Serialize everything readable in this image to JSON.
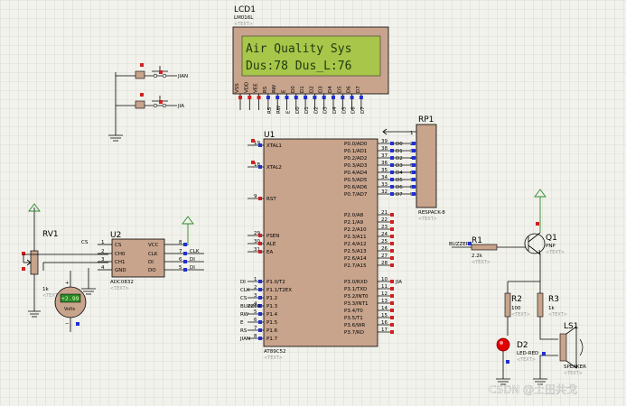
{
  "lcd": {
    "ref": "LCD1",
    "model": "LM016L",
    "text_tag": "<TEXT>",
    "line1": "Air Quality Sys",
    "line2": "Dus:78  Dus_L:76",
    "pins": [
      "VSS",
      "VDD",
      "VEE",
      "RS",
      "RW",
      "E",
      "D0",
      "D1",
      "D2",
      "D3",
      "D4",
      "D5",
      "D6",
      "D7"
    ],
    "nets": [
      "RS",
      "RW",
      "E",
      "D0",
      "D1",
      "D2",
      "D3",
      "D4",
      "D5",
      "D6",
      "D7"
    ]
  },
  "mcu": {
    "ref": "U1",
    "model": "AT89C52",
    "text_tag": "<TEXT>",
    "left_pins": [
      {
        "num": "19",
        "name": "XTAL1"
      },
      {
        "num": "18",
        "name": "XTAL2"
      },
      {
        "num": "9",
        "name": "RST"
      },
      {
        "num": "29",
        "name": "PSEN"
      },
      {
        "num": "30",
        "name": "ALE"
      },
      {
        "num": "31",
        "name": "EA"
      },
      {
        "num": "1",
        "name": "P1.0/T2"
      },
      {
        "num": "2",
        "name": "P1.1/T2EX"
      },
      {
        "num": "3",
        "name": "P1.2"
      },
      {
        "num": "4",
        "name": "P1.3"
      },
      {
        "num": "5",
        "name": "P1.4"
      },
      {
        "num": "6",
        "name": "P1.5"
      },
      {
        "num": "7",
        "name": "P1.6"
      },
      {
        "num": "8",
        "name": "P1.7"
      }
    ],
    "left_nets": [
      "DI",
      "CLK",
      "CS",
      "BUZZER",
      "RW",
      "E",
      "RS",
      "JIAN"
    ],
    "right_p0": [
      {
        "num": "39",
        "name": "P0.0/AD0"
      },
      {
        "num": "38",
        "name": "P0.1/AD1"
      },
      {
        "num": "37",
        "name": "P0.2/AD2"
      },
      {
        "num": "36",
        "name": "P0.3/AD3"
      },
      {
        "num": "35",
        "name": "P0.4/AD4"
      },
      {
        "num": "34",
        "name": "P0.5/AD5"
      },
      {
        "num": "33",
        "name": "P0.6/AD6"
      },
      {
        "num": "32",
        "name": "P0.7/AD7"
      }
    ],
    "p0_nets": [
      "D0",
      "D1",
      "D2",
      "D3",
      "D4",
      "D5",
      "D6",
      "D7"
    ],
    "right_p2": [
      {
        "num": "21",
        "name": "P2.0/A8"
      },
      {
        "num": "22",
        "name": "P2.1/A9"
      },
      {
        "num": "23",
        "name": "P2.2/A10"
      },
      {
        "num": "24",
        "name": "P2.3/A11"
      },
      {
        "num": "25",
        "name": "P2.4/A12"
      },
      {
        "num": "26",
        "name": "P2.5/A13"
      },
      {
        "num": "27",
        "name": "P2.6/A14"
      },
      {
        "num": "28",
        "name": "P2.7/A15"
      }
    ],
    "right_p3": [
      {
        "num": "10",
        "name": "P3.0/RXD"
      },
      {
        "num": "11",
        "name": "P3.1/TXD"
      },
      {
        "num": "12",
        "name": "P3.2/INT0"
      },
      {
        "num": "13",
        "name": "P3.3/INT1"
      },
      {
        "num": "14",
        "name": "P3.4/T0"
      },
      {
        "num": "15",
        "name": "P3.5/T1"
      },
      {
        "num": "16",
        "name": "P3.6/WR"
      },
      {
        "num": "17",
        "name": "P3.7/RD"
      }
    ],
    "p3_net": "JIA"
  },
  "rp1": {
    "ref": "RP1",
    "model": "RESPACK-8",
    "text_tag": "<TEXT>",
    "pin1": "1",
    "pins": [
      "2",
      "3",
      "4",
      "5",
      "6",
      "7",
      "8",
      "9"
    ]
  },
  "adc": {
    "ref": "U2",
    "model": "ADC0832",
    "text_tag": "<TEXT>",
    "left_pins": [
      "CS",
      "CH0",
      "CH1",
      "GND"
    ],
    "right_pins": [
      "VCC",
      "CLK",
      "DI",
      "DO"
    ],
    "left_nums": [
      "1",
      "2",
      "3",
      "4"
    ],
    "right_nums": [
      "8",
      "7",
      "6",
      "5"
    ],
    "left_net": "CS",
    "right_nets": [
      "CLK",
      "DI",
      "DI"
    ]
  },
  "rv1": {
    "ref": "RV1",
    "value": "1k",
    "text_tag": "<TEXT>"
  },
  "voltmeter": {
    "reading": "+2.99",
    "unit": "Volts"
  },
  "buttons": [
    {
      "net": "JIAN"
    },
    {
      "net": "JIA"
    }
  ],
  "buzzer_net": "BUZZER",
  "r1": {
    "ref": "R1",
    "value": "2.2k",
    "text_tag": "<TEXT>"
  },
  "q1": {
    "ref": "Q1",
    "model": "PNP",
    "text_tag": "<TEXT>"
  },
  "r2": {
    "ref": "R2",
    "value": "100",
    "text_tag": "<TEXT>"
  },
  "r3": {
    "ref": "R3",
    "value": "1k",
    "text_tag": "<TEXT>"
  },
  "d2": {
    "ref": "D2",
    "model": "LED-RED",
    "text_tag": "<TEXT>"
  },
  "ls1": {
    "ref": "LS1",
    "model": "SPEAKER",
    "text_tag": "<TEXT>"
  },
  "watermark": "CSDN @土田共戈",
  "colors": {
    "grid": "#c9c9c0",
    "component": "#c8a48c",
    "lcd_screen": "#a8c64a",
    "pin_red": "#d02020",
    "pin_blue": "#2030d0",
    "wire": "#000000",
    "led": "#e00000",
    "meter": "#2a8a2a"
  }
}
